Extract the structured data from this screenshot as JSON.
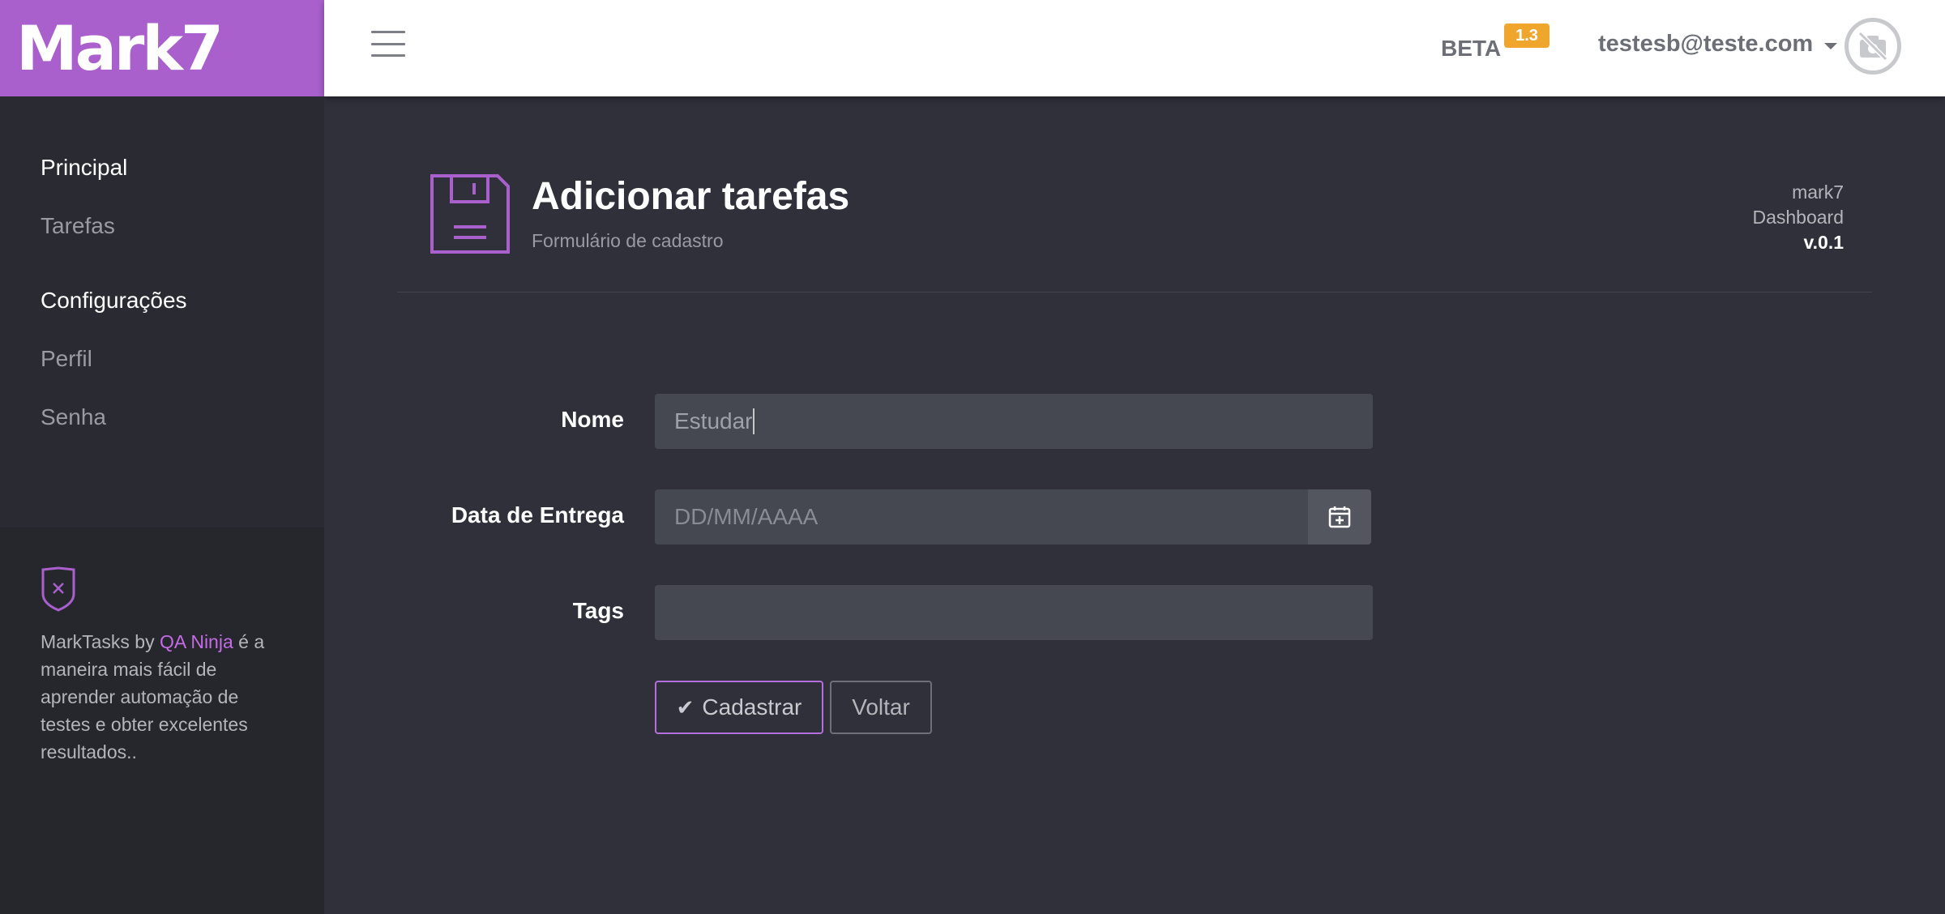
{
  "brand": {
    "logo_text": "Mark7",
    "color": "#a960cc"
  },
  "topbar": {
    "menu_icon": "hamburger-icon",
    "beta_label": "BETA",
    "beta_version": "1.3",
    "user_email": "testesb@teste.com",
    "avatar_icon": "no-photo-icon"
  },
  "sidebar": {
    "sections": [
      {
        "title": "Principal",
        "items": [
          "Tarefas"
        ]
      },
      {
        "title": "Configurações",
        "items": [
          "Perfil",
          "Senha"
        ]
      }
    ],
    "footer": {
      "icon": "shield-x-icon",
      "text_before": "MarkTasks by ",
      "link_text": "QA Ninja",
      "text_after": " é a maneira mais fácil de aprender automação de testes e obter excelentes resultados.."
    }
  },
  "page": {
    "icon": "floppy-disk-icon",
    "title": "Adicionar tarefas",
    "subtitle": "Formulário de cadastro",
    "version_lines": [
      "mark7",
      "Dashboard"
    ],
    "version": "v.0.1"
  },
  "form": {
    "name": {
      "label": "Nome",
      "value": "Estudar",
      "placeholder": ""
    },
    "date": {
      "label": "Data de Entrega",
      "value": "",
      "placeholder": "DD/MM/AAAA",
      "icon": "calendar-plus-icon"
    },
    "tags": {
      "label": "Tags",
      "value": "",
      "placeholder": ""
    },
    "submit_label": "Cadastrar",
    "submit_icon": "check-icon",
    "back_label": "Voltar"
  },
  "colors": {
    "accent": "#a960cc",
    "badge": "#f0a52d",
    "background": "#2f3039",
    "sidebar": "#2a2b32",
    "input": "#464851"
  }
}
